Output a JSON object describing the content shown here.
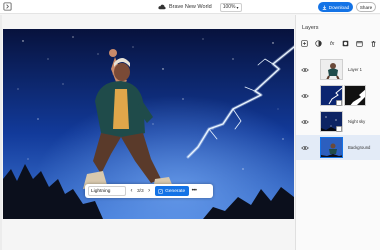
{
  "topbar": {
    "doc_title": "Brave New World",
    "zoom": "100%",
    "download_label": "Download",
    "share_label": "Share"
  },
  "panel": {
    "title": "Layers",
    "layers": [
      {
        "name": "Layer 1"
      },
      {
        "name": ""
      },
      {
        "name": "Night sky"
      },
      {
        "name": "Background"
      }
    ]
  },
  "context_bar": {
    "prompt_value": "Lightning",
    "count": "3/3",
    "generate_label": "Generate"
  },
  "colors": {
    "accent": "#1473e6",
    "selected_layer": "#e3ebf7"
  }
}
